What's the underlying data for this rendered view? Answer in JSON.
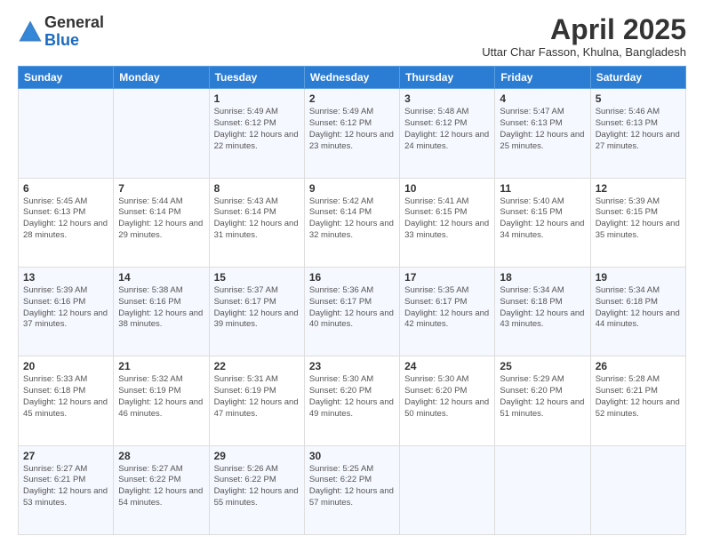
{
  "header": {
    "logo_general": "General",
    "logo_blue": "Blue",
    "month_year": "April 2025",
    "location": "Uttar Char Fasson, Khulna, Bangladesh"
  },
  "days_of_week": [
    "Sunday",
    "Monday",
    "Tuesday",
    "Wednesday",
    "Thursday",
    "Friday",
    "Saturday"
  ],
  "weeks": [
    [
      {
        "day": "",
        "info": ""
      },
      {
        "day": "",
        "info": ""
      },
      {
        "day": "1",
        "info": "Sunrise: 5:49 AM\nSunset: 6:12 PM\nDaylight: 12 hours and 22 minutes."
      },
      {
        "day": "2",
        "info": "Sunrise: 5:49 AM\nSunset: 6:12 PM\nDaylight: 12 hours and 23 minutes."
      },
      {
        "day": "3",
        "info": "Sunrise: 5:48 AM\nSunset: 6:12 PM\nDaylight: 12 hours and 24 minutes."
      },
      {
        "day": "4",
        "info": "Sunrise: 5:47 AM\nSunset: 6:13 PM\nDaylight: 12 hours and 25 minutes."
      },
      {
        "day": "5",
        "info": "Sunrise: 5:46 AM\nSunset: 6:13 PM\nDaylight: 12 hours and 27 minutes."
      }
    ],
    [
      {
        "day": "6",
        "info": "Sunrise: 5:45 AM\nSunset: 6:13 PM\nDaylight: 12 hours and 28 minutes."
      },
      {
        "day": "7",
        "info": "Sunrise: 5:44 AM\nSunset: 6:14 PM\nDaylight: 12 hours and 29 minutes."
      },
      {
        "day": "8",
        "info": "Sunrise: 5:43 AM\nSunset: 6:14 PM\nDaylight: 12 hours and 31 minutes."
      },
      {
        "day": "9",
        "info": "Sunrise: 5:42 AM\nSunset: 6:14 PM\nDaylight: 12 hours and 32 minutes."
      },
      {
        "day": "10",
        "info": "Sunrise: 5:41 AM\nSunset: 6:15 PM\nDaylight: 12 hours and 33 minutes."
      },
      {
        "day": "11",
        "info": "Sunrise: 5:40 AM\nSunset: 6:15 PM\nDaylight: 12 hours and 34 minutes."
      },
      {
        "day": "12",
        "info": "Sunrise: 5:39 AM\nSunset: 6:15 PM\nDaylight: 12 hours and 35 minutes."
      }
    ],
    [
      {
        "day": "13",
        "info": "Sunrise: 5:39 AM\nSunset: 6:16 PM\nDaylight: 12 hours and 37 minutes."
      },
      {
        "day": "14",
        "info": "Sunrise: 5:38 AM\nSunset: 6:16 PM\nDaylight: 12 hours and 38 minutes."
      },
      {
        "day": "15",
        "info": "Sunrise: 5:37 AM\nSunset: 6:17 PM\nDaylight: 12 hours and 39 minutes."
      },
      {
        "day": "16",
        "info": "Sunrise: 5:36 AM\nSunset: 6:17 PM\nDaylight: 12 hours and 40 minutes."
      },
      {
        "day": "17",
        "info": "Sunrise: 5:35 AM\nSunset: 6:17 PM\nDaylight: 12 hours and 42 minutes."
      },
      {
        "day": "18",
        "info": "Sunrise: 5:34 AM\nSunset: 6:18 PM\nDaylight: 12 hours and 43 minutes."
      },
      {
        "day": "19",
        "info": "Sunrise: 5:34 AM\nSunset: 6:18 PM\nDaylight: 12 hours and 44 minutes."
      }
    ],
    [
      {
        "day": "20",
        "info": "Sunrise: 5:33 AM\nSunset: 6:18 PM\nDaylight: 12 hours and 45 minutes."
      },
      {
        "day": "21",
        "info": "Sunrise: 5:32 AM\nSunset: 6:19 PM\nDaylight: 12 hours and 46 minutes."
      },
      {
        "day": "22",
        "info": "Sunrise: 5:31 AM\nSunset: 6:19 PM\nDaylight: 12 hours and 47 minutes."
      },
      {
        "day": "23",
        "info": "Sunrise: 5:30 AM\nSunset: 6:20 PM\nDaylight: 12 hours and 49 minutes."
      },
      {
        "day": "24",
        "info": "Sunrise: 5:30 AM\nSunset: 6:20 PM\nDaylight: 12 hours and 50 minutes."
      },
      {
        "day": "25",
        "info": "Sunrise: 5:29 AM\nSunset: 6:20 PM\nDaylight: 12 hours and 51 minutes."
      },
      {
        "day": "26",
        "info": "Sunrise: 5:28 AM\nSunset: 6:21 PM\nDaylight: 12 hours and 52 minutes."
      }
    ],
    [
      {
        "day": "27",
        "info": "Sunrise: 5:27 AM\nSunset: 6:21 PM\nDaylight: 12 hours and 53 minutes."
      },
      {
        "day": "28",
        "info": "Sunrise: 5:27 AM\nSunset: 6:22 PM\nDaylight: 12 hours and 54 minutes."
      },
      {
        "day": "29",
        "info": "Sunrise: 5:26 AM\nSunset: 6:22 PM\nDaylight: 12 hours and 55 minutes."
      },
      {
        "day": "30",
        "info": "Sunrise: 5:25 AM\nSunset: 6:22 PM\nDaylight: 12 hours and 57 minutes."
      },
      {
        "day": "",
        "info": ""
      },
      {
        "day": "",
        "info": ""
      },
      {
        "day": "",
        "info": ""
      }
    ]
  ]
}
